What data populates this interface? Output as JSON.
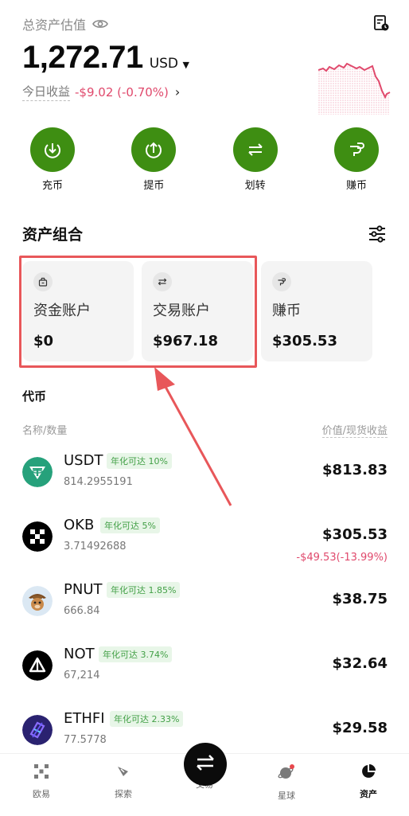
{
  "header": {
    "total_label": "总资产估值",
    "balance": "1,272.71",
    "currency": "USD",
    "today_label": "今日收益",
    "today_value": "-$9.02 (-0.70%)",
    "today_arrow": "›"
  },
  "actions": [
    {
      "label": "充币",
      "icon": "deposit-icon"
    },
    {
      "label": "提币",
      "icon": "withdraw-icon"
    },
    {
      "label": "划转",
      "icon": "transfer-icon"
    },
    {
      "label": "赚币",
      "icon": "earn-icon"
    }
  ],
  "portfolio": {
    "title": "资产组合",
    "cards": [
      {
        "name": "资金账户",
        "value": "$0",
        "icon": "wallet-icon"
      },
      {
        "name": "交易账户",
        "value": "$967.18",
        "icon": "swap-icon"
      },
      {
        "name": "赚币",
        "value": "$305.53",
        "icon": "earn-icon"
      }
    ]
  },
  "tokens": {
    "title": "代币",
    "col_left": "名称/数量",
    "col_right": "价值/现货收益",
    "items": [
      {
        "symbol": "USDT",
        "apy": "年化可达 10%",
        "amount": "814.2955191",
        "value": "$813.83",
        "pnl": ""
      },
      {
        "symbol": "OKB",
        "apy": "年化可达 5%",
        "amount": "3.71492688",
        "value": "$305.53",
        "pnl": "-$49.53(-13.99%)"
      },
      {
        "symbol": "PNUT",
        "apy": "年化可达 1.85%",
        "amount": "666.84",
        "value": "$38.75",
        "pnl": ""
      },
      {
        "symbol": "NOT",
        "apy": "年化可达 3.74%",
        "amount": "67,214",
        "value": "$32.64",
        "pnl": ""
      },
      {
        "symbol": "ETHFI",
        "apy": "年化可达 2.33%",
        "amount": "77.5778",
        "value": "$29.58",
        "pnl": ""
      }
    ]
  },
  "nav": [
    {
      "label": "欧易",
      "icon": "okx-logo-icon"
    },
    {
      "label": "探索",
      "icon": "compass-icon"
    },
    {
      "label": "交易",
      "icon": "trade-swap-icon"
    },
    {
      "label": "星球",
      "icon": "planet-icon"
    },
    {
      "label": "资产",
      "icon": "pie-chart-icon"
    }
  ],
  "colors": {
    "action_green": "#3e8e12",
    "negative": "#e0496c",
    "apy_green": "#43a047",
    "highlight_red": "#e8575a"
  }
}
